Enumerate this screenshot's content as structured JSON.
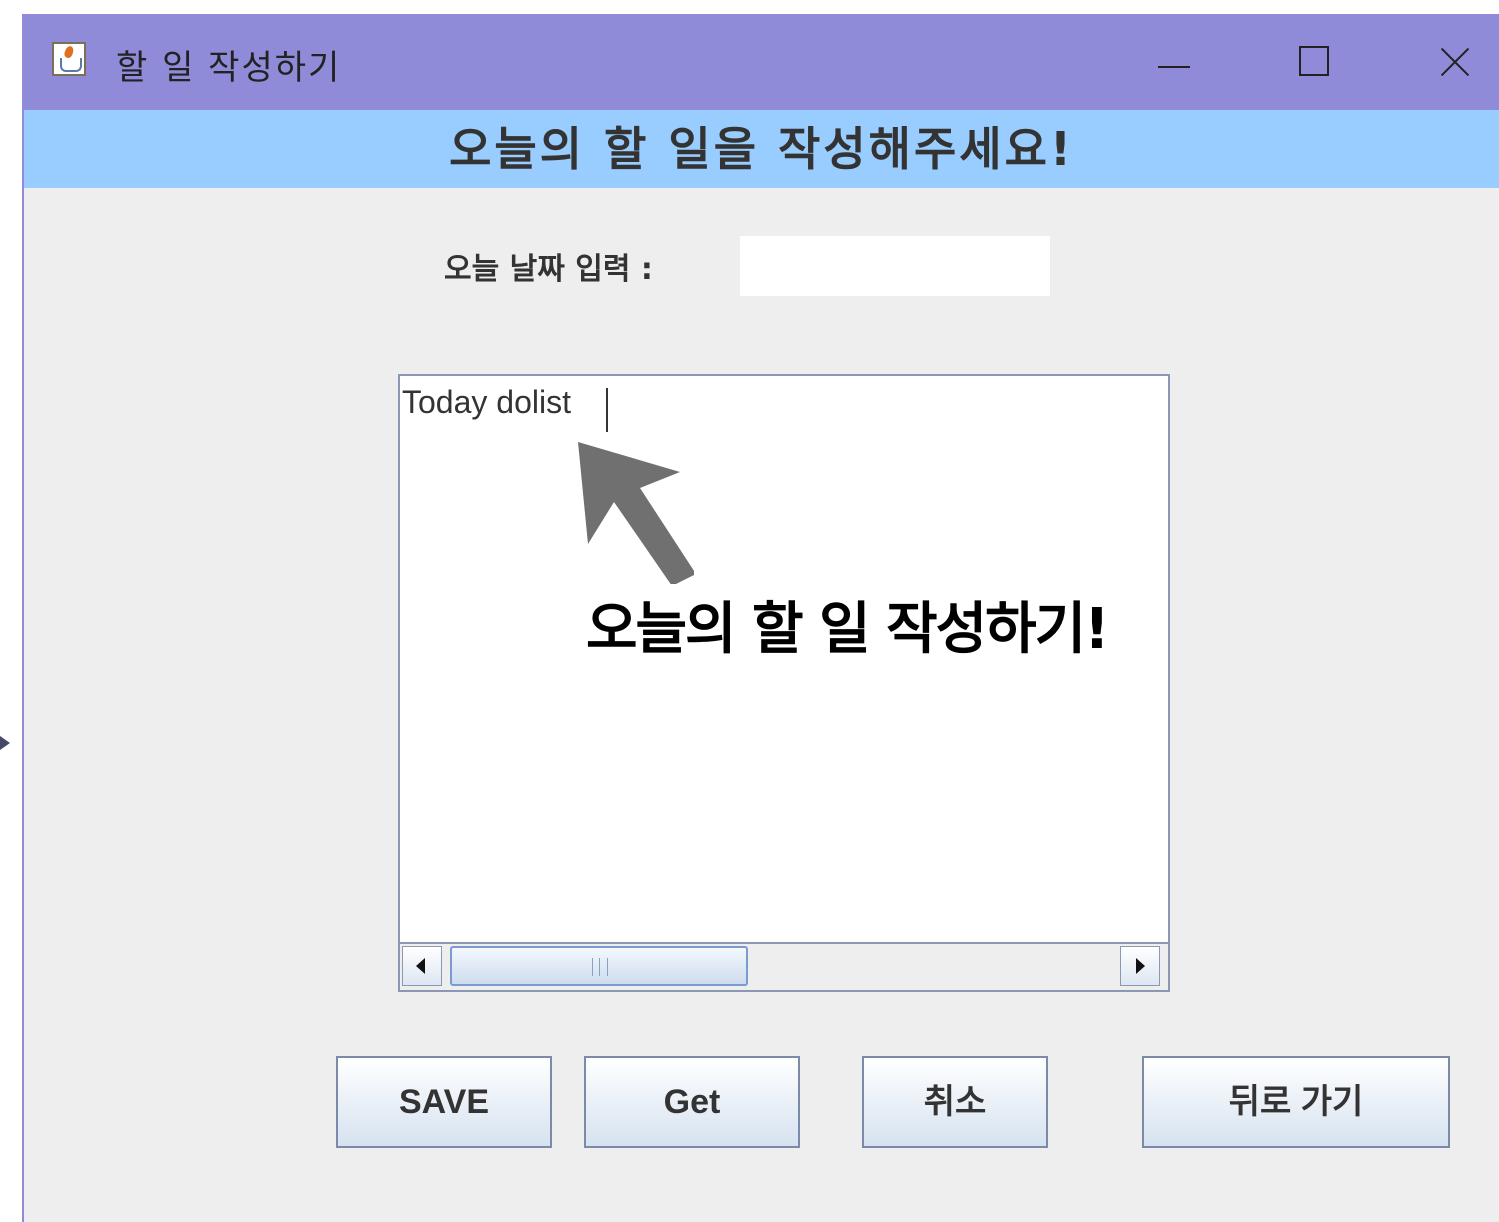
{
  "window": {
    "title": "할 일 작성하기"
  },
  "header": {
    "title": "오늘의 할 일을 작성해주세요!"
  },
  "form": {
    "date_label": "오늘 날짜 입력 :",
    "date_value": "",
    "todo_text": "Today dolist"
  },
  "annotation": {
    "text": "오늘의 할 일 작성하기!"
  },
  "buttons": {
    "save": "SAVE",
    "get": "Get",
    "cancel": "취소",
    "back": "뒤로 가기"
  },
  "colors": {
    "titlebar": "#8f8bd8",
    "header_banner": "#99ccff",
    "window_bg": "#eeeeee",
    "annotation_arrow": "#707070"
  },
  "icons": {
    "app": "java-cup-icon",
    "minimize": "minimize-icon",
    "maximize": "maximize-icon",
    "close": "close-icon"
  }
}
